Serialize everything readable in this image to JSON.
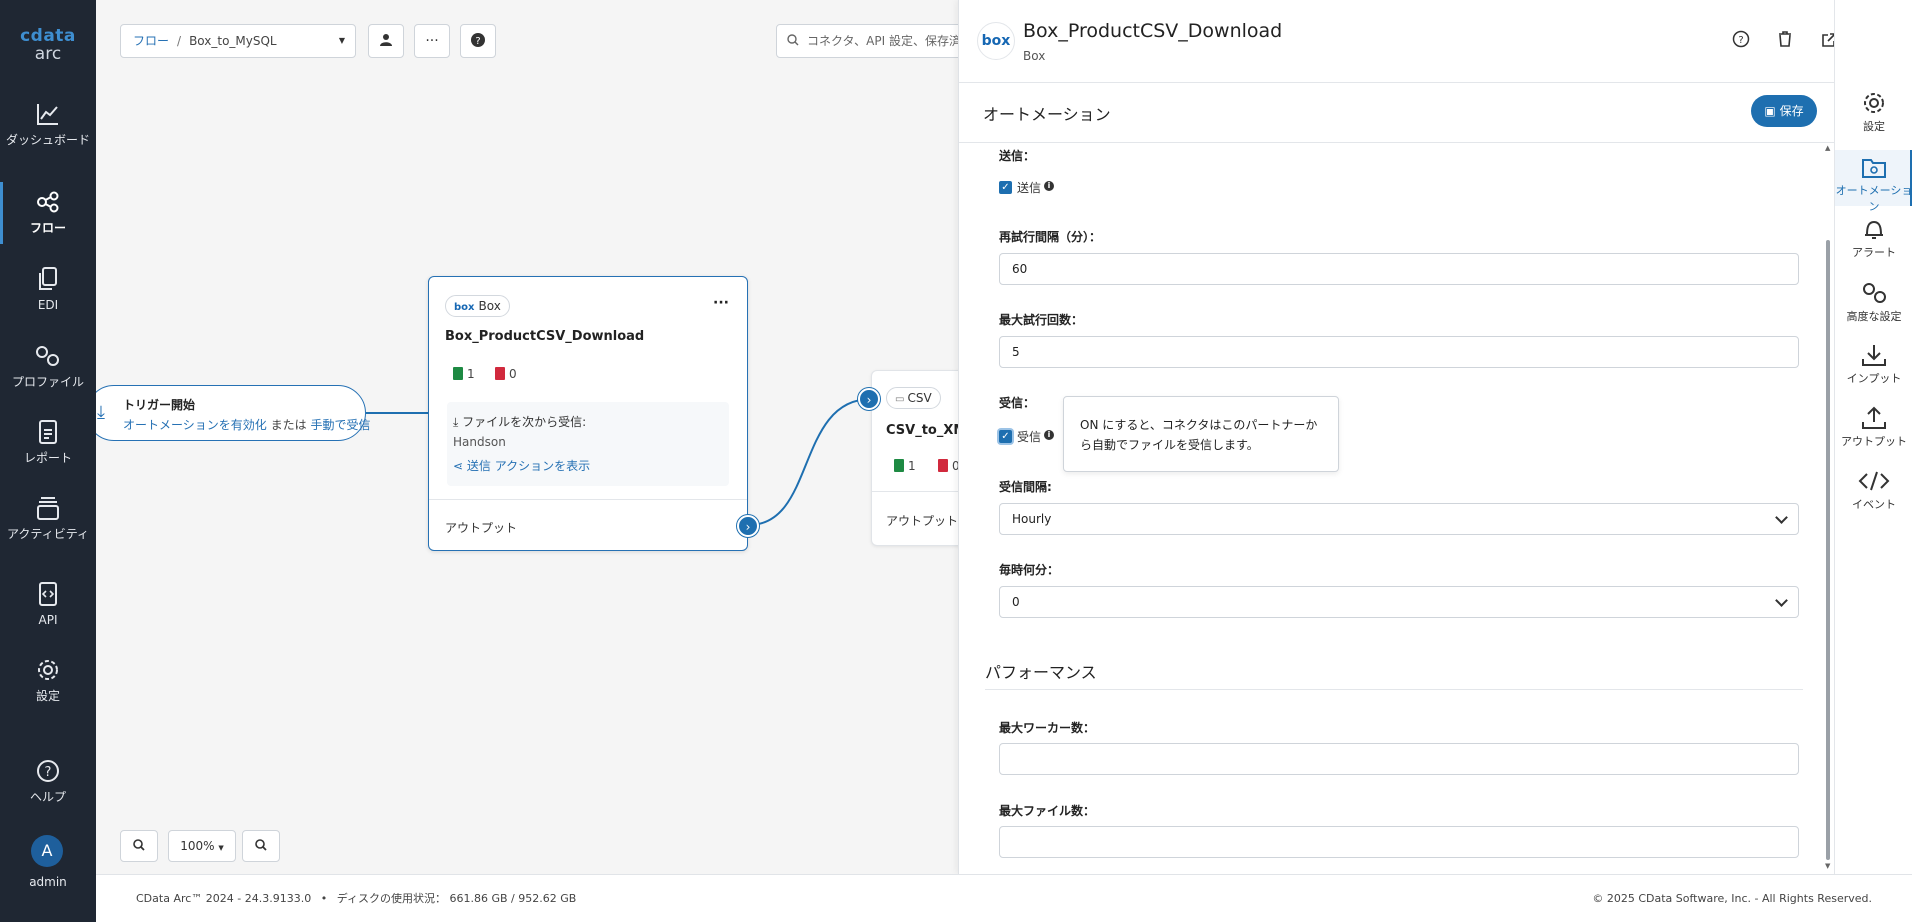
{
  "sidebar": {
    "logo_top": "cdata",
    "logo_bottom": "arc",
    "items": [
      {
        "label": "ダッシュボード",
        "icon": "chart-line-icon"
      },
      {
        "label": "フロー",
        "icon": "flow-icon",
        "active": true
      },
      {
        "label": "EDI",
        "icon": "copy-documents-icon"
      },
      {
        "label": "プロファイル",
        "icon": "gears-icon"
      },
      {
        "label": "レポート",
        "icon": "report-icon"
      },
      {
        "label": "アクティビティ",
        "icon": "activity-icon"
      },
      {
        "label": "API",
        "icon": "api-file-icon"
      },
      {
        "label": "設定",
        "icon": "gear-icon"
      },
      {
        "label": "ヘルプ",
        "icon": "help-circle-icon"
      }
    ],
    "user": {
      "initial": "A",
      "name": "admin"
    }
  },
  "toolbar": {
    "breadcrumb_root": "フロー",
    "breadcrumb_sep": "/",
    "flow_name": "Box_to_MySQL",
    "search_placeholder": "コネクタ、API 設定、保存済み"
  },
  "canvas": {
    "trigger": {
      "title": "トリガー開始",
      "link_enable": "オートメーションを有効化",
      "or_text": "または",
      "link_manual": "手動で受信"
    },
    "box_node": {
      "chip": "Box",
      "chip_logo": "box",
      "title": "Box_ProductCSV_Download",
      "success_count": "1",
      "error_count": "0",
      "receive_label": "ファイルを次から受信:",
      "receive_source": "Handson",
      "send_link": "送信 アクションを表示",
      "output_label": "アウトプット",
      "menu": "···"
    },
    "csv_node": {
      "chip": "CSV",
      "title": "CSV_to_XML",
      "success_count": "1",
      "error_count": "0",
      "output_label": "アウトプット"
    },
    "zoom_level": "100%",
    "zoom_in_icon": "zoom-in-icon",
    "zoom_out_icon": "zoom-out-icon"
  },
  "panel": {
    "logo": "box",
    "title": "Box_ProductCSV_Download",
    "subtitle": "Box",
    "section_title": "オートメーション",
    "save_label": "保存",
    "fields": {
      "send_label": "送信：",
      "send_checkbox_label": "送信",
      "send_checked": true,
      "retry_interval_label": "再試行間隔（分）：",
      "retry_interval_value": "60",
      "max_attempts_label": "最大試行回数：",
      "max_attempts_value": "5",
      "receive_label": "受信：",
      "receive_checkbox_label": "受信",
      "receive_checked": true,
      "receive_tooltip": "ON にすると、コネクタはこのパートナーから自動でファイルを受信します。",
      "receive_interval_label": "受信間隔:",
      "receive_interval_value": "Hourly",
      "minute_label": "毎時何分：",
      "minute_value": "0"
    },
    "performance": {
      "title": "パフォーマンス",
      "max_workers_label": "最大ワーカー数：",
      "max_workers_value": "",
      "max_files_label": "最大ファイル数：",
      "max_files_value": ""
    }
  },
  "rail": {
    "items": [
      {
        "label": "設定",
        "icon": "gear-icon"
      },
      {
        "label": "オートメーション",
        "icon": "folder-gear-icon",
        "active": true
      },
      {
        "label": "アラート",
        "icon": "bell-icon"
      },
      {
        "label": "高度な設定",
        "icon": "gears-icon"
      },
      {
        "label": "インプット",
        "icon": "download-icon"
      },
      {
        "label": "アウトプット",
        "icon": "upload-icon"
      },
      {
        "label": "イベント",
        "icon": "code-icon"
      }
    ]
  },
  "footer": {
    "version": "CData Arc™ 2024 - 24.3.9133.0",
    "disk_label": "ディスクの使用状況：",
    "disk_value": "661.86 GB / 952.62 GB",
    "bullet": "•",
    "copyright": "© 2025 CData Software, Inc. - All Rights Reserved."
  },
  "colors": {
    "accent": "#1e6fb0",
    "sidebar_bg": "#1f2733",
    "success": "#1e8a43",
    "error": "#d1293d"
  }
}
